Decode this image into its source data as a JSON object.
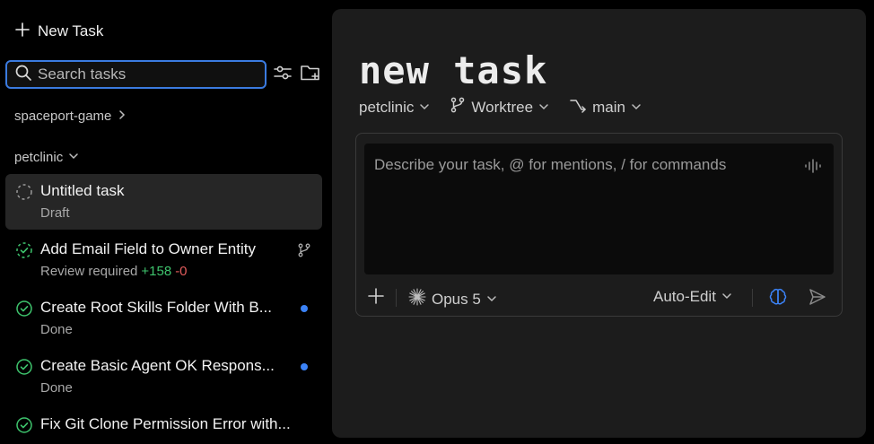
{
  "sidebar": {
    "new_task_label": "New Task",
    "search_placeholder": "Search tasks",
    "groups": [
      {
        "label": "spaceport-game",
        "expanded": false
      },
      {
        "label": "petclinic",
        "expanded": true
      }
    ],
    "tasks": [
      {
        "title": "Untitled task",
        "status": "Draft",
        "state": "draft"
      },
      {
        "title": "Add Email Field to Owner Entity",
        "status": "Review required",
        "additions": "+158",
        "deletions": "-0",
        "state": "review"
      },
      {
        "title": "Create Root Skills Folder With B...",
        "status": "Done",
        "state": "done"
      },
      {
        "title": "Create Basic Agent OK Respons...",
        "status": "Done",
        "state": "done"
      },
      {
        "title": "Fix Git Clone Permission Error with...",
        "status": "",
        "state": "done"
      }
    ]
  },
  "main": {
    "title": "new task",
    "project": "petclinic",
    "worktree": "Worktree",
    "branch": "main",
    "composer": {
      "placeholder": "Describe your task, @ for mentions, / for commands",
      "model": "Opus 5",
      "mode": "Auto-Edit"
    }
  },
  "colors": {
    "accent": "#3b7be0",
    "success": "#3ec46d",
    "danger": "#e25c5c",
    "unread_dot": "#3b82f6",
    "panel": "#1c1c1c"
  }
}
